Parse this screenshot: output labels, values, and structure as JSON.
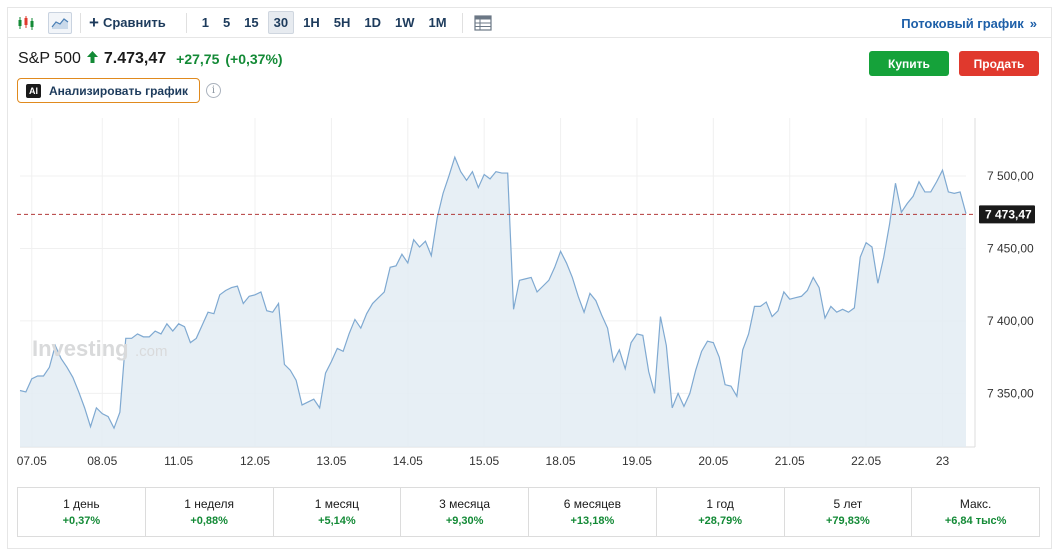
{
  "toolbar": {
    "compare_label": "Сравнить",
    "intervals": [
      "1",
      "5",
      "15",
      "30",
      "1H",
      "5H",
      "1D",
      "1W",
      "1M"
    ],
    "active_interval": "30",
    "stream_label": "Потоковый график"
  },
  "quote": {
    "name": "S&P 500",
    "price": "7.473,47",
    "change": "+27,75",
    "change_pct": "(+0,37%)",
    "up_color": "#138a36"
  },
  "actions": {
    "buy_label": "Купить",
    "sell_label": "Продать",
    "analyze_label": "Анализировать график",
    "ai_badge": "AI"
  },
  "watermark": {
    "brand": "Investing",
    "suffix": ".com"
  },
  "chart_data": {
    "type": "area",
    "line_color": "#7fa9d1",
    "fill_color": "#e3ecf3",
    "last_price_label": "7 473,47",
    "last_price": 7473.47,
    "ylim": [
      7313,
      7540
    ],
    "y_ticks": [
      {
        "value": 7350,
        "label": "7 350,00"
      },
      {
        "value": 7400,
        "label": "7 400,00"
      },
      {
        "value": 7450,
        "label": "7 450,00"
      },
      {
        "value": 7500,
        "label": "7 500,00"
      }
    ],
    "x_ticks": [
      {
        "index": 2,
        "label": "07.05"
      },
      {
        "index": 14,
        "label": "08.05"
      },
      {
        "index": 27,
        "label": "11.05"
      },
      {
        "index": 40,
        "label": "12.05"
      },
      {
        "index": 53,
        "label": "13.05"
      },
      {
        "index": 66,
        "label": "14.05"
      },
      {
        "index": 79,
        "label": "15.05"
      },
      {
        "index": 92,
        "label": "18.05"
      },
      {
        "index": 105,
        "label": "19.05"
      },
      {
        "index": 118,
        "label": "20.05"
      },
      {
        "index": 131,
        "label": "21.05"
      },
      {
        "index": 144,
        "label": "22.05"
      },
      {
        "index": 157,
        "label": "23"
      }
    ],
    "values": [
      7352,
      7351,
      7360,
      7362,
      7362,
      7368,
      7383,
      7374,
      7368,
      7361,
      7351,
      7340,
      7327,
      7340,
      7336,
      7334,
      7326,
      7337,
      7388,
      7388,
      7391,
      7389,
      7389,
      7393,
      7391,
      7398,
      7393,
      7398,
      7396,
      7385,
      7388,
      7397,
      7406,
      7405,
      7418,
      7421,
      7423,
      7424,
      7412,
      7417,
      7418,
      7420,
      7407,
      7406,
      7412,
      7370,
      7366,
      7359,
      7342,
      7344,
      7346,
      7340,
      7364,
      7372,
      7381,
      7379,
      7391,
      7401,
      7395,
      7405,
      7412,
      7416,
      7420,
      7437,
      7438,
      7446,
      7440,
      7456,
      7451,
      7455,
      7445,
      7471,
      7488,
      7500,
      7513,
      7503,
      7497,
      7503,
      7492,
      7501,
      7498,
      7503,
      7502,
      7502,
      7408,
      7428,
      7429,
      7430,
      7420,
      7424,
      7428,
      7437,
      7448,
      7440,
      7430,
      7417,
      7406,
      7419,
      7414,
      7404,
      7395,
      7372,
      7380,
      7367,
      7385,
      7391,
      7390,
      7365,
      7350,
      7403,
      7383,
      7340,
      7350,
      7341,
      7350,
      7366,
      7379,
      7386,
      7385,
      7375,
      7356,
      7355,
      7348,
      7380,
      7391,
      7410,
      7410,
      7413,
      7403,
      7407,
      7420,
      7415,
      7416,
      7417,
      7421,
      7430,
      7423,
      7402,
      7410,
      7406,
      7408,
      7406,
      7409,
      7444,
      7454,
      7451,
      7426,
      7444,
      7467,
      7495,
      7475,
      7481,
      7486,
      7496,
      7489,
      7489,
      7496,
      7504,
      7489,
      7488,
      7489,
      7474
    ]
  },
  "performance": [
    {
      "label": "1 день",
      "value": "+0,37%"
    },
    {
      "label": "1 неделя",
      "value": "+0,88%"
    },
    {
      "label": "1 месяц",
      "value": "+5,14%"
    },
    {
      "label": "3 месяца",
      "value": "+9,30%"
    },
    {
      "label": "6 месяцев",
      "value": "+13,18%"
    },
    {
      "label": "1 год",
      "value": "+28,79%"
    },
    {
      "label": "5 лет",
      "value": "+79,83%"
    },
    {
      "label": "Макс.",
      "value": "+6,84 тыс%"
    }
  ]
}
